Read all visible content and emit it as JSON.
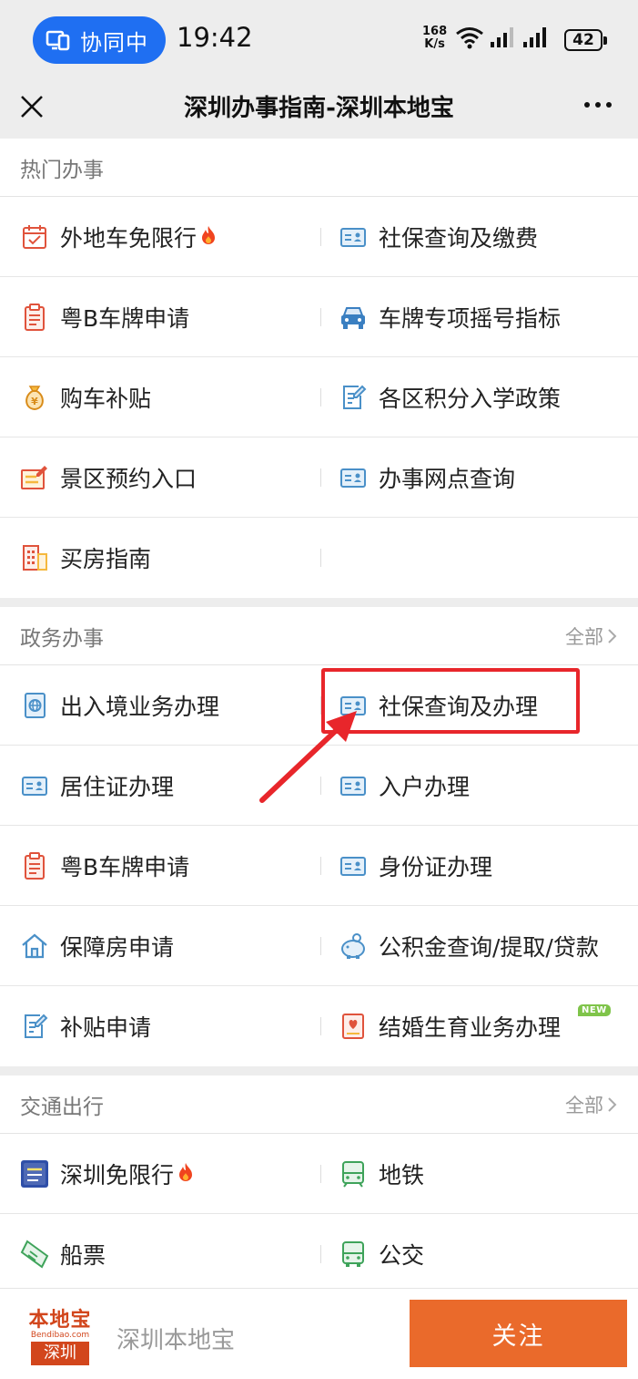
{
  "status_bar": {
    "collab_label": "协同中",
    "time": "19:42",
    "net_speed_value": "168",
    "net_speed_unit": "K/s",
    "battery": "42"
  },
  "nav": {
    "title": "深圳办事指南-深圳本地宝"
  },
  "sections": {
    "hot": {
      "title": "热门办事",
      "rows": [
        [
          {
            "label": "外地车免限行",
            "icon": "calendar-check-icon"
          },
          {
            "label": "社保查询及缴费",
            "icon": "id-card-icon"
          }
        ],
        [
          {
            "label": "粤B车牌申请",
            "icon": "clipboard-icon"
          },
          {
            "label": "车牌专项摇号指标",
            "icon": "car-icon"
          }
        ],
        [
          {
            "label": "购车补贴",
            "icon": "money-bag-icon"
          },
          {
            "label": "各区积分入学政策",
            "icon": "document-edit-icon"
          }
        ],
        [
          {
            "label": "景区预约入口",
            "icon": "form-edit-icon"
          },
          {
            "label": "办事网点查询",
            "icon": "id-card-icon"
          }
        ],
        [
          {
            "label": "买房指南",
            "icon": "building-icon"
          }
        ]
      ]
    },
    "gov": {
      "title": "政务办事",
      "all_label": "全部",
      "rows": [
        [
          {
            "label": "出入境业务办理",
            "icon": "passport-icon"
          },
          {
            "label": "社保查询及办理",
            "icon": "id-card-icon"
          }
        ],
        [
          {
            "label": "居住证办理",
            "icon": "id-card-icon"
          },
          {
            "label": "入户办理",
            "icon": "id-card-icon"
          }
        ],
        [
          {
            "label": "粤B车牌申请",
            "icon": "clipboard-icon"
          },
          {
            "label": "身份证办理",
            "icon": "id-card-icon"
          }
        ],
        [
          {
            "label": "保障房申请",
            "icon": "house-icon"
          },
          {
            "label": "公积金查询/提取/贷款",
            "icon": "piggy-bank-icon"
          }
        ],
        [
          {
            "label": "补贴申请",
            "icon": "document-edit-icon"
          },
          {
            "label": "结婚生育业务办理",
            "icon": "heart-certificate-icon"
          }
        ]
      ],
      "new_badge": "NEW"
    },
    "traffic": {
      "title": "交通出行",
      "all_label": "全部",
      "rows": [
        [
          {
            "label": "深圳免限行",
            "icon": "restriction-policy-icon"
          },
          {
            "label": "地铁",
            "icon": "metro-icon"
          }
        ],
        [
          {
            "label": "船票",
            "icon": "ticket-icon"
          },
          {
            "label": "公交",
            "icon": "bus-icon"
          }
        ]
      ]
    }
  },
  "footer": {
    "logo_text": "本地宝",
    "logo_domain": "Bendibao.com",
    "logo_city": "深圳",
    "brand_name": "深圳本地宝",
    "follow_label": "关注"
  },
  "colors": {
    "accent_orange": "#ea6a2b",
    "collab_blue": "#1f6ff2",
    "highlight_red": "#e8262b",
    "icon_blue": "#4a90c8",
    "icon_red": "#e0533c"
  }
}
